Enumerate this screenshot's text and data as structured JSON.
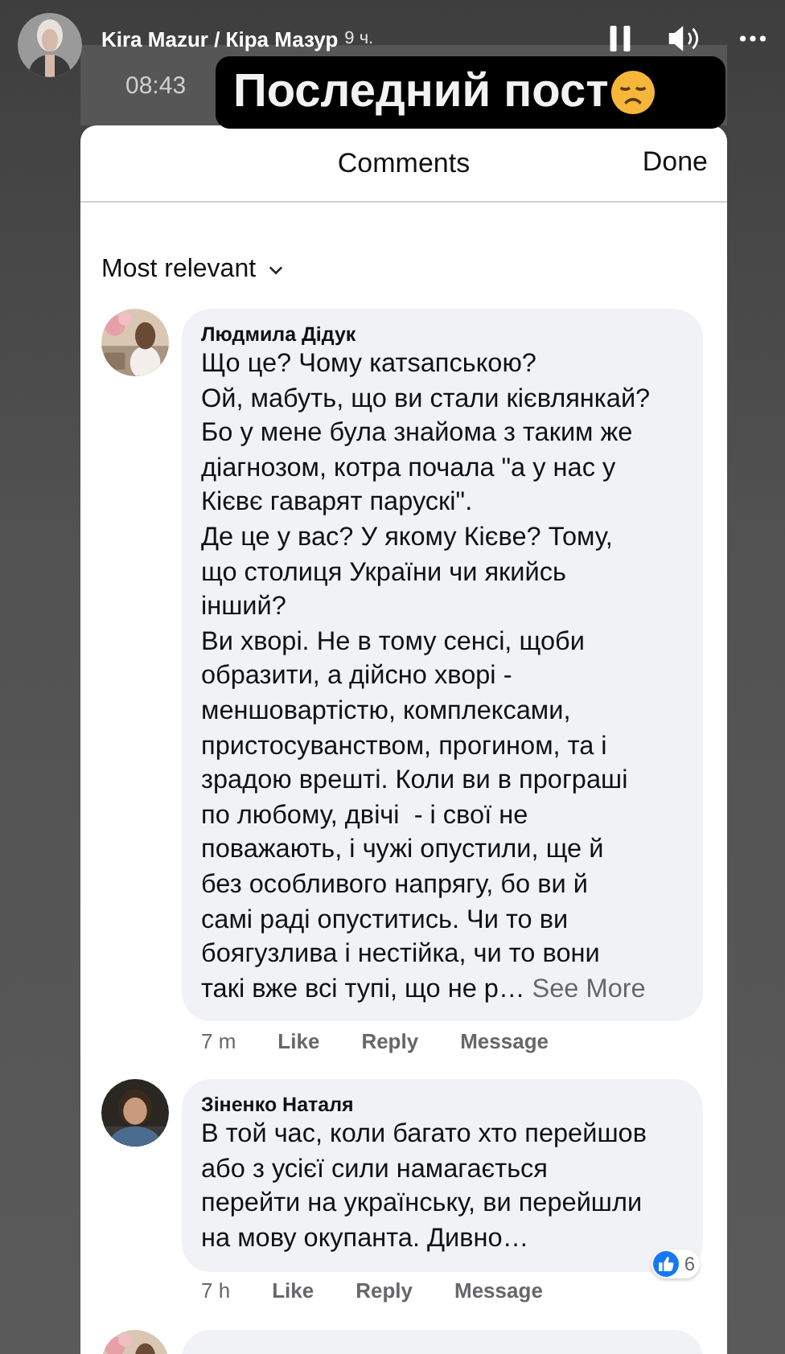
{
  "story": {
    "author": "Kira Mazur / Кіра Мазур",
    "time": "9 ч."
  },
  "screenshot": {
    "clock": "08:43",
    "sticker": "Последний пост",
    "sheet": {
      "title": "Comments",
      "done": "Done",
      "sort": "Most relevant"
    },
    "comments": [
      {
        "author": "Людмила Дідук",
        "text": "Що це? Чому катsапською?\nОй, мабуть, що ви стали кієвлянкай?\nБо у мене була знайома з таким же\nдіагнозом, котра почала \"а у нас у\nКієвє гаварят парускі\".\nДе це у вас? У якому Кієве? Тому,\nщо столиця України чи якийсь\nінший?\nВи хворі. Не в тому сенсі, щоби\nобразити, а дійсно хворі -\nменшовартістю, комплексами,\nпристосуванством, прогином, та і\nзрадою врешті. Коли ви в програші\nпо любому, двічі  - і свої не\nповажають, і чужі опустили, ще й\nбез особливого напрягу, бо ви й\nсамі раді опуститись. Чи то ви\nбоягузлива і нестійка, чи то вони\nтакі вже всі тупі, що не р…",
        "see_more": "See More",
        "time": "7 m",
        "actions": [
          "Like",
          "Reply",
          "Message"
        ]
      },
      {
        "author": "Зіненко Наталя",
        "text": "В той час, коли багато хто перейшов\nабо з усієї сили намагається\nперейти на українську, ви перейшли\nна мову окупанта. Дивно…",
        "time": "7 h",
        "actions": [
          "Like",
          "Reply",
          "Message"
        ],
        "reactions": "6"
      }
    ]
  }
}
